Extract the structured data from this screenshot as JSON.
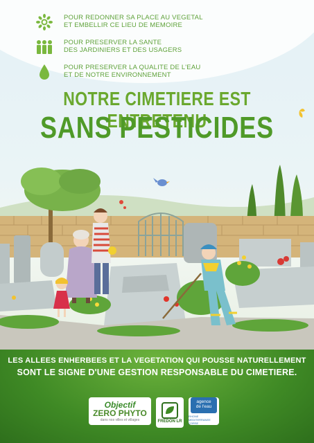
{
  "benefits": [
    {
      "icon": "sunflower-icon",
      "line1": "POUR REDONNER SA PLACE AU VEGETAL",
      "line2": "ET EMBELLIR CE LIEU DE MEMOIRE"
    },
    {
      "icon": "people-icon",
      "line1": "POUR PRESERVER LA SANTE",
      "line2": "DES JARDINIERS ET DES USAGERS"
    },
    {
      "icon": "water-drop-icon",
      "line1": "POUR PRESERVER LA QUALITE DE L'EAU",
      "line2": "ET DE NOTRE ENVIRONNEMENT"
    }
  ],
  "title": {
    "line1": "NOTRE CIMETIERE EST ENTRETENU",
    "line2": "SANS PESTICIDES"
  },
  "message": {
    "line1": "LES ALLEES ENHERBEES ET LA VEGETATION QUI POUSSE NATURELLEMENT",
    "line2": "SONT LE SIGNE D'UNE GESTION RESPONSABLE DU CIMETIERE."
  },
  "logos": {
    "phyto_a": "Objectif",
    "phyto_b": "ZERO PHYTO",
    "phyto_c": "dans nos villes et villages",
    "fredon": "FREDON LR",
    "agence_a": "agence",
    "agence_b": "de l'eau",
    "agence_sub": "RHONE MEDITERRANEE CORSE"
  },
  "colors": {
    "title_green": "#4f9a28",
    "text_green": "#5fa23a",
    "band_green": "#3f8a25"
  }
}
